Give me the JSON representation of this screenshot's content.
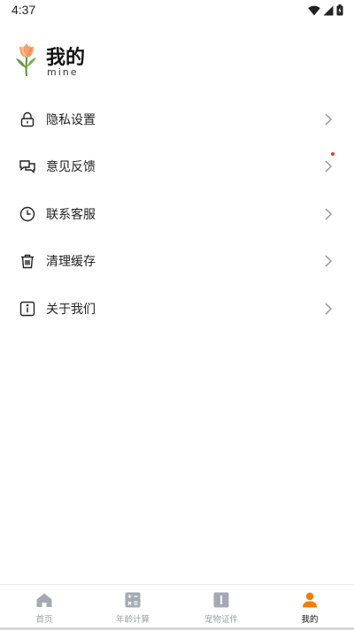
{
  "status_bar": {
    "time": "4:37"
  },
  "header": {
    "title": "我的",
    "subtitle": "mine"
  },
  "menu": {
    "items": [
      {
        "label": "隐私设置",
        "icon": "lock-icon"
      },
      {
        "label": "意见反馈",
        "icon": "chat-bubbles-icon",
        "badge_dot": true
      },
      {
        "label": "联系客服",
        "icon": "clock-icon"
      },
      {
        "label": "清理缓存",
        "icon": "trash-icon"
      },
      {
        "label": "关于我们",
        "icon": "info-icon"
      }
    ]
  },
  "bottom_nav": {
    "items": [
      {
        "label": "首页",
        "icon": "home-icon",
        "active": false
      },
      {
        "label": "年龄计算",
        "icon": "calculator-icon",
        "active": false
      },
      {
        "label": "宠物证件",
        "icon": "certificate-icon",
        "active": false
      },
      {
        "label": "我的",
        "icon": "person-icon",
        "active": true
      }
    ]
  },
  "colors": {
    "accent": "#f57c00",
    "inactive": "#9aa0a6",
    "badge": "#e53935"
  }
}
